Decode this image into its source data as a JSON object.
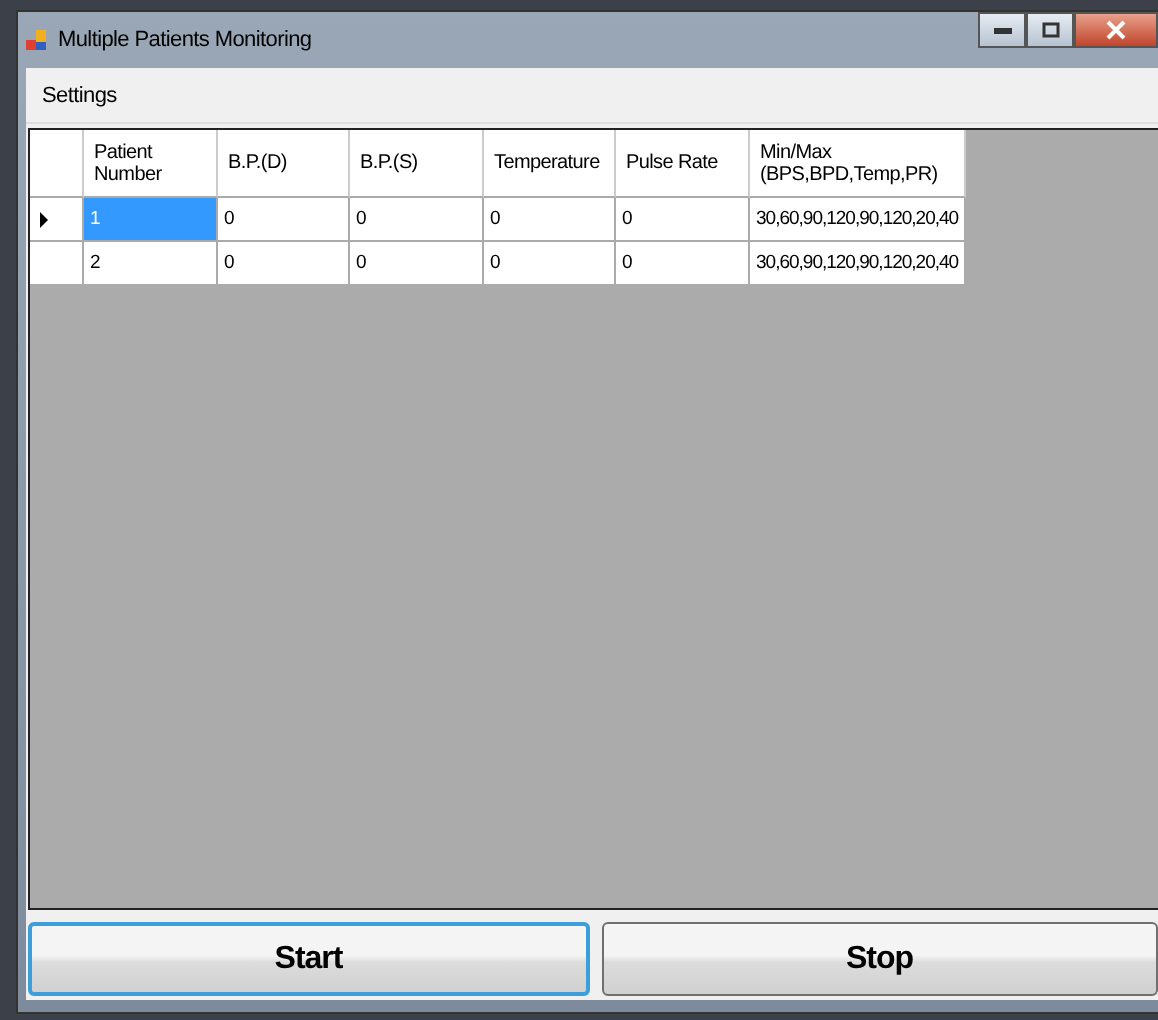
{
  "window": {
    "title": "Multiple Patients Monitoring"
  },
  "menu": [
    {
      "label": "Settings"
    }
  ],
  "table": {
    "columns": [
      "Patient\nNumber",
      "B.P.(D)",
      "B.P.(S)",
      "Temperature",
      "Pulse Rate",
      "Min/Max\n(BPS,BPD,Temp,PR)"
    ],
    "rows": [
      {
        "selected": true,
        "cells": [
          "1",
          "0",
          "0",
          "0",
          "0",
          "30,60,90,120,90,120,20,40"
        ]
      },
      {
        "selected": false,
        "cells": [
          "2",
          "0",
          "0",
          "0",
          "0",
          "30,60,90,120,90,120,20,40"
        ]
      }
    ]
  },
  "buttons": [
    {
      "label": "Start",
      "focused": true
    },
    {
      "label": "Stop",
      "focused": false
    }
  ]
}
